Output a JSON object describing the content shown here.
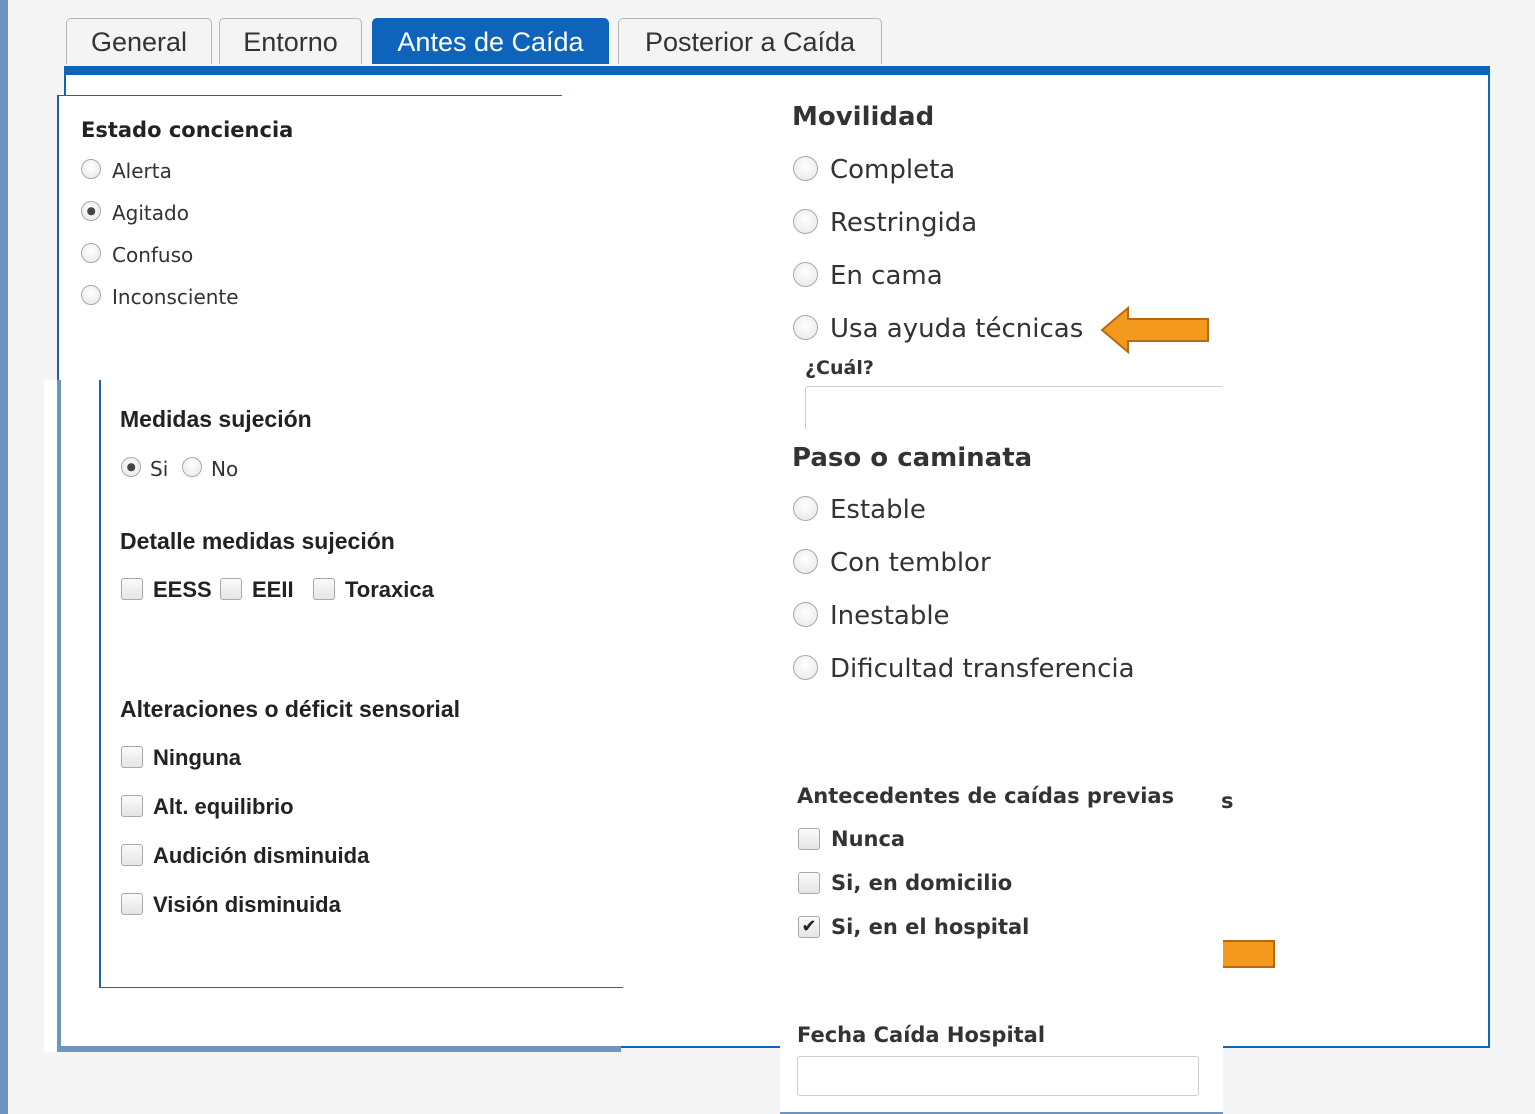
{
  "tabs": [
    "General",
    "Entorno",
    "Antes de Caída",
    "Posterior a Caída"
  ],
  "estado": {
    "title": "Estado conciencia",
    "options": [
      "Alerta",
      "Agitado",
      "Confuso",
      "Inconsciente"
    ],
    "selected": "Agitado"
  },
  "medidas": {
    "title": "Medidas sujeción",
    "options": [
      "Si",
      "No"
    ],
    "selected": "Si"
  },
  "detalle": {
    "title": "Detalle medidas sujeción",
    "options": [
      "EESS",
      "EEII",
      "Toraxica"
    ]
  },
  "alteraciones": {
    "title": "Alteraciones o déficit sensorial",
    "options": [
      "Ninguna",
      "Alt. equilibrio",
      "Audición disminuida",
      "Visión disminuida"
    ]
  },
  "movilidad": {
    "title": "Movilidad",
    "options": [
      "Completa",
      "Restringida",
      "En cama",
      "Usa ayuda técnicas"
    ],
    "cual_label": "¿Cuál?",
    "cual_value": ""
  },
  "paso": {
    "title": "Paso o caminata",
    "options": [
      "Estable",
      "Con temblor",
      "Inestable",
      "Dificultad transferencia"
    ]
  },
  "antecedentes": {
    "title": "Antecedentes de caídas previas",
    "stray_letter": "s",
    "options": [
      "Nunca",
      "Si, en domicilio",
      "Si, en el hospital"
    ],
    "checked": "Si, en el hospital"
  },
  "fecha": {
    "label": "Fecha Caída Hospital",
    "value": ""
  },
  "colors": {
    "accent": "#0e64bb",
    "arrow": "#f39a1e",
    "arrow_border": "#b8690f"
  }
}
